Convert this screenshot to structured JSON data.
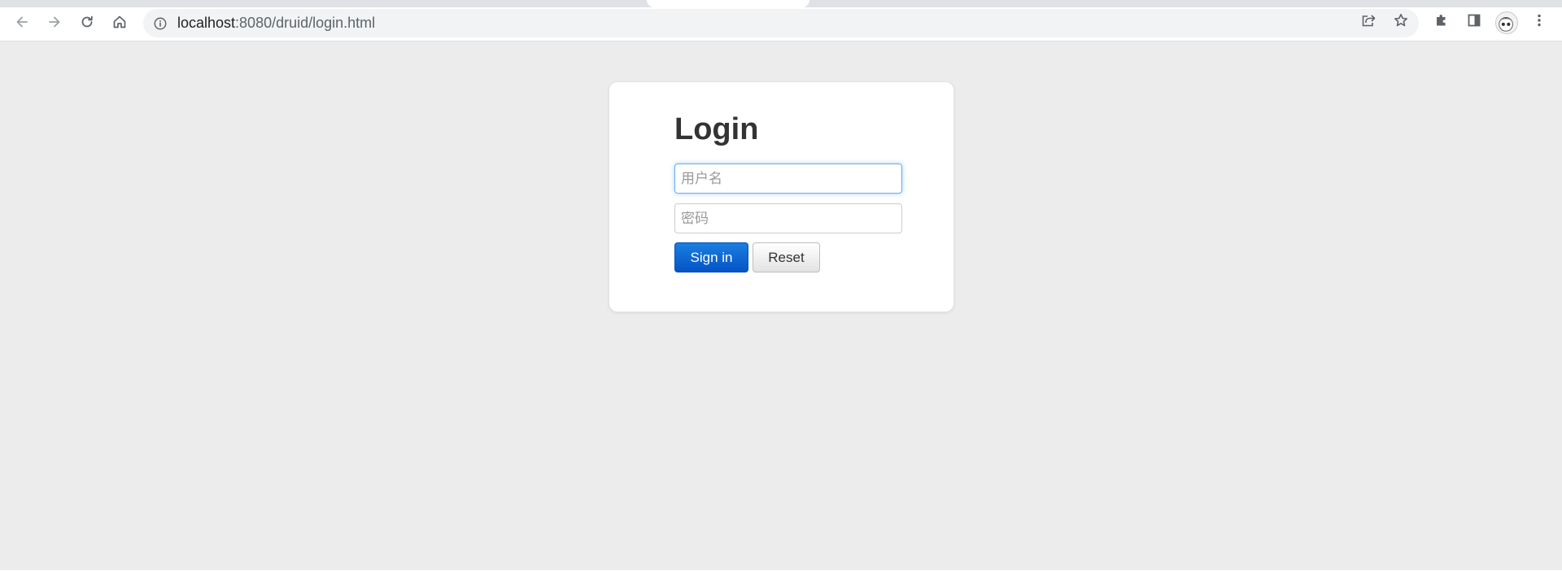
{
  "browser": {
    "url_host": "localhost",
    "url_path": ":8080/druid/login.html",
    "icons": {
      "back": "arrow-left-icon",
      "forward": "arrow-right-icon",
      "reload": "reload-icon",
      "home": "home-icon",
      "info": "info-icon",
      "share": "share-icon",
      "bookmark": "star-icon",
      "extensions": "puzzle-icon",
      "side_panel": "side-panel-icon",
      "profile": "avatar",
      "menu": "kebab-menu-icon"
    }
  },
  "login": {
    "title": "Login",
    "username_placeholder": "用户名",
    "password_placeholder": "密码",
    "signin_label": "Sign in",
    "reset_label": "Reset"
  },
  "colors": {
    "page_bg": "#ececec",
    "primary_button": "#0554c6",
    "focus_border": "#6faee6"
  }
}
